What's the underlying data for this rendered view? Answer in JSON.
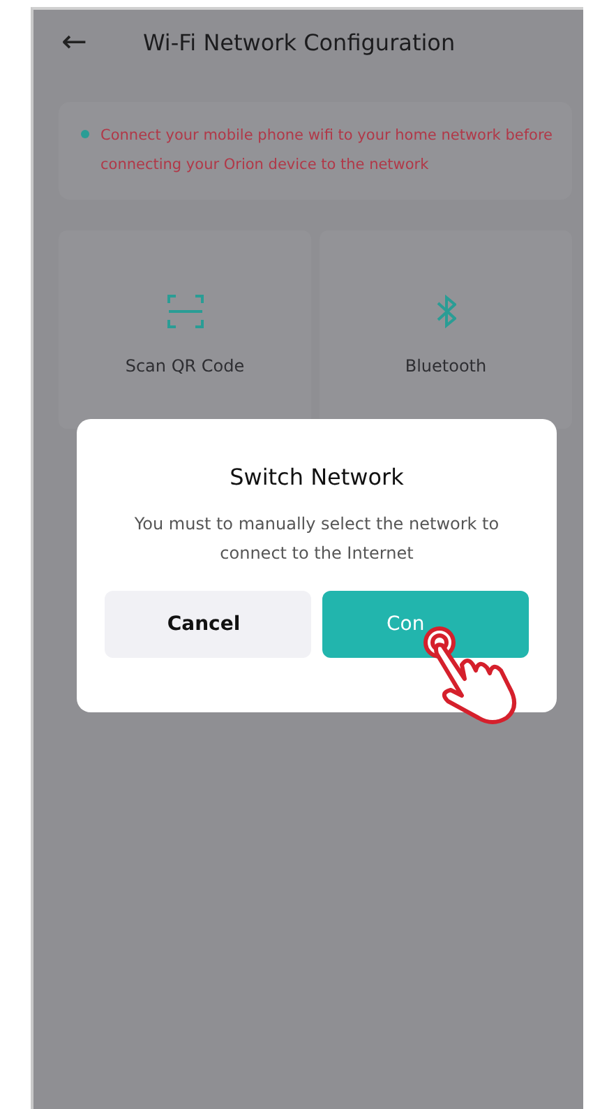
{
  "header": {
    "back": "←",
    "title": "Wi-Fi Network Configuration"
  },
  "notice": "Connect your mobile phone wifi to your home network before connecting your Orion device to the network",
  "options": [
    {
      "kind": "qr",
      "label": "Scan QR Code"
    },
    {
      "kind": "bluetooth",
      "label": "Bluetooth"
    }
  ],
  "dialog": {
    "title": "Switch Network",
    "message": "You must to manually select the network to connect to the Internet",
    "buttons": [
      {
        "kind": "secondary",
        "label": "Cancel"
      },
      {
        "kind": "primary",
        "label": "Con"
      }
    ]
  }
}
